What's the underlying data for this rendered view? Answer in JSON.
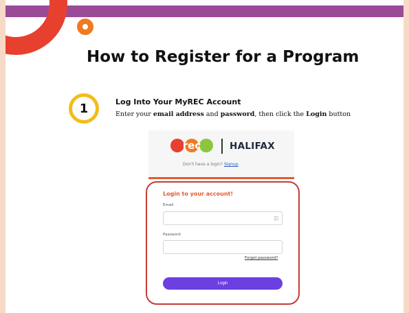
{
  "document": {
    "title": "How to Register for a Program",
    "step": {
      "number": "1",
      "title": "Log Into Your MyREC Account",
      "desc_part1": "Enter your ",
      "desc_bold1": "email address",
      "desc_part2": " and ",
      "desc_bold2": "password",
      "desc_part3": ", then click the ",
      "desc_bold3": "Login",
      "desc_part4": " button"
    }
  },
  "screenshot": {
    "logo_text": "rec",
    "brand": "HALIFAX",
    "no_login_text": "Don't have a login?",
    "signup_link": "Signup",
    "login_heading": "Login to your account!",
    "email_label": "Email",
    "password_label": "Password",
    "forgot_link": "Forgot password?",
    "login_button": "Login"
  },
  "colors": {
    "top_bar": "#9b4a98",
    "accent_red": "#e8402f",
    "accent_orange": "#f07a22",
    "step_ring": "#f2bd1a",
    "login_button": "#6b3fe0"
  }
}
